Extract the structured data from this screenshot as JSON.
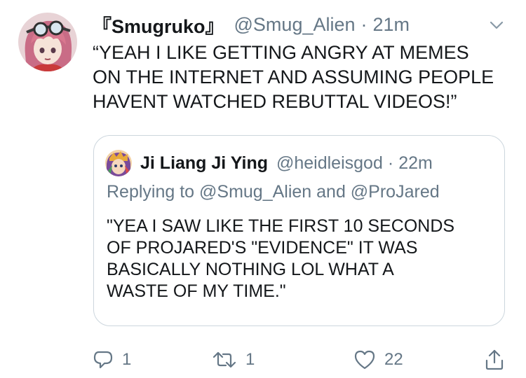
{
  "tweet": {
    "display_name": "『Smugruko』",
    "handle": "@Smug_Alien",
    "separator": "·",
    "time": "21m",
    "text": "“YEAH I LIKE GETTING ANGRY AT MEMES\nON THE INTERNET AND ASSUMING PEOPLE\nHAVENT WATCHED REBUTTAL VIDEOS!”",
    "avatar_icon": "anime-avatar-pink-hair-goggles",
    "menu_icon": "chevron-down-icon"
  },
  "quoted_tweet": {
    "display_name": "Ji Liang Ji Ying",
    "handle": "@heidleisgod",
    "separator": "·",
    "time": "22m",
    "reply_context": "Replying to @Smug_Alien and @ProJared",
    "text": "\"YEA I SAW LIKE THE FIRST 10 SECONDS\nOF PROJARED'S \"EVIDENCE\" IT WAS\nBASICALLY NOTHING LOL WHAT A\nWASTE OF MY TIME.\"",
    "avatar_icon": "anime-avatar-colorful"
  },
  "actions": {
    "reply_count": "1",
    "retweet_count": "1",
    "like_count": "22"
  },
  "colors": {
    "text_primary": "#14171a",
    "text_secondary": "#657786",
    "border": "#ccd6dd",
    "background": "#ffffff"
  }
}
